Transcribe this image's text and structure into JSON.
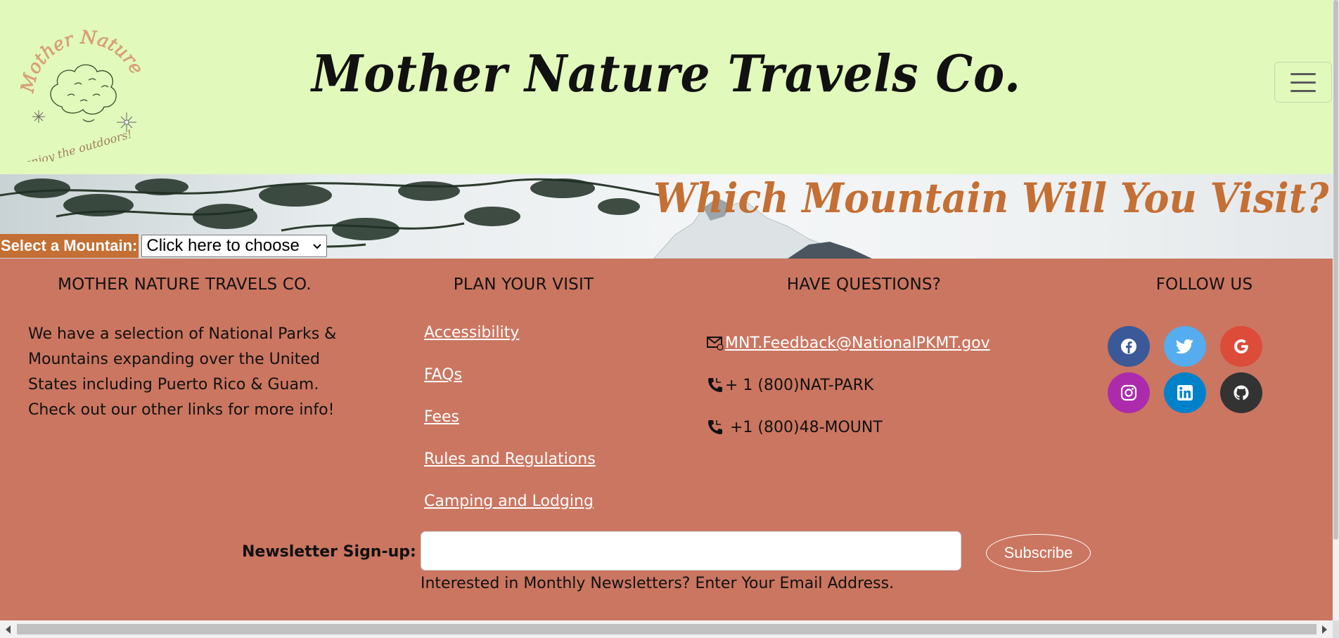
{
  "header": {
    "logo": {
      "arc_text": "Mother Nature",
      "tagline": "enjoy the outdoors!"
    },
    "title": "Mother Nature Travels Co.",
    "menu_icon": "hamburger-icon"
  },
  "banner": {
    "heading": "Which Mountain Will You Visit?",
    "select_label": "Select a Mountain:",
    "select_value": "Click here to choose"
  },
  "footer": {
    "about": {
      "heading": "MOTHER NATURE TRAVELS CO.",
      "text": "We have a selection of National Parks & Mountains expanding over the United States including Puerto Rico & Guam. Check out our other links for more info!"
    },
    "plan": {
      "heading": "PLAN YOUR VISIT",
      "links": [
        "Accessibility",
        "FAQs",
        "Fees",
        "Rules and Regulations",
        "Camping and Lodging"
      ]
    },
    "questions": {
      "heading": "HAVE QUESTIONS?",
      "email": "MNT.Feedback@NationalPKMT.gov",
      "phone1": "+ 1 (800)NAT-PARK",
      "phone2": " +1 (800)48-MOUNT"
    },
    "follow": {
      "heading": "FOLLOW US",
      "icons": [
        "facebook-icon",
        "twitter-icon",
        "google-icon",
        "instagram-icon",
        "linkedin-icon",
        "github-icon"
      ],
      "colors": [
        "#3b5998",
        "#55acee",
        "#dd4b39",
        "#ac2bac",
        "#0082ca",
        "#333333"
      ]
    },
    "newsletter": {
      "label": "Newsletter Sign-up:",
      "input_value": "",
      "button": "Subscribe",
      "help": "Interested in Monthly Newsletters? Enter Your Email Address."
    }
  },
  "colors": {
    "header_bg": "#e1f9bb",
    "footer_bg": "#cb7661",
    "accent": "#c46f34"
  }
}
